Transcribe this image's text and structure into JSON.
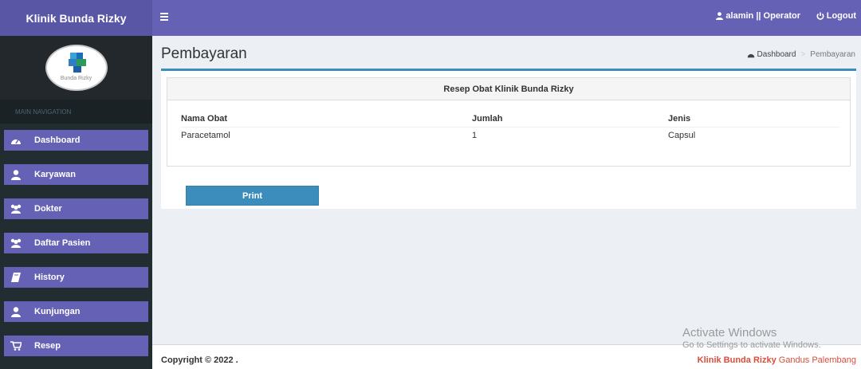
{
  "app": {
    "title": "Klinik Bunda Rizky"
  },
  "topbar": {
    "user": "alamin || Operator",
    "logout": "Logout"
  },
  "sidebar": {
    "logo_text": "Bunda Rizky",
    "nav_header": "MAIN NAVIGATION",
    "items": [
      {
        "label": "Dashboard",
        "icon": "dashboard-icon"
      },
      {
        "label": "Karyawan",
        "icon": "user-icon"
      },
      {
        "label": "Dokter",
        "icon": "users-icon"
      },
      {
        "label": "Daftar Pasien",
        "icon": "users-icon"
      },
      {
        "label": "History",
        "icon": "book-icon"
      },
      {
        "label": "Kunjungan",
        "icon": "user-icon"
      },
      {
        "label": "Resep",
        "icon": "cart-icon"
      }
    ]
  },
  "page": {
    "title": "Pembayaran",
    "breadcrumb": {
      "home": "Dashboard",
      "current": "Pembayaran"
    }
  },
  "prescription": {
    "heading": "Resep Obat Klinik Bunda Rizky",
    "columns": [
      "Nama Obat",
      "Jumlah",
      "Jenis"
    ],
    "rows": [
      [
        "Paracetamol",
        "1",
        "Capsul"
      ]
    ],
    "print_label": "Print"
  },
  "footer": {
    "copyright": "Copyright © 2022 .",
    "clinic_name": "Klinik Bunda Rizky",
    "clinic_location": " Gandus Palembang"
  },
  "watermark": {
    "line1": "Activate Windows",
    "line2": "Go to Settings to activate Windows."
  }
}
